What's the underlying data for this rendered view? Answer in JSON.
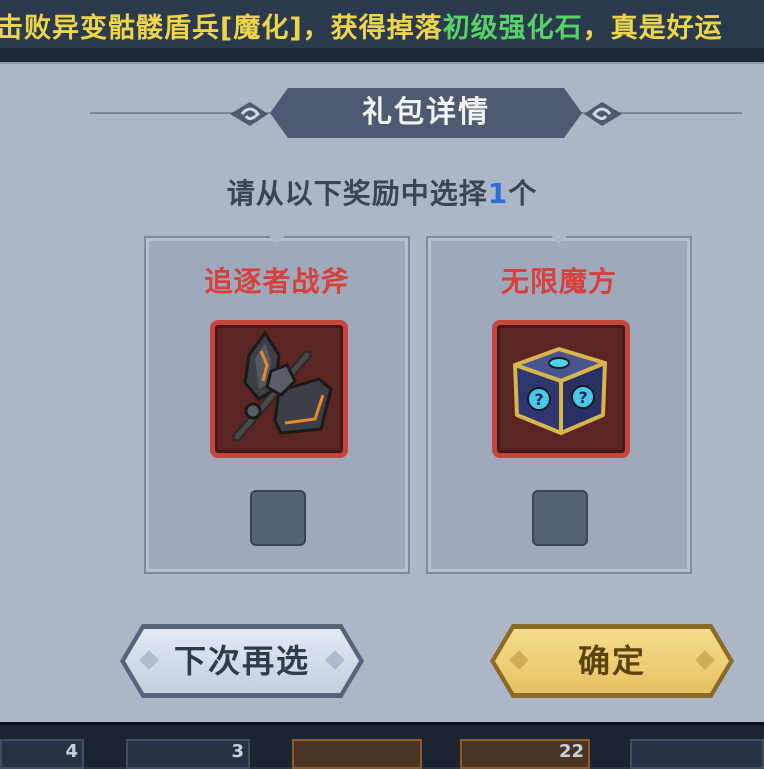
{
  "broadcast": {
    "part1": "击败异变骷髅盾兵[魔化]，获得掉落",
    "item": "初级强化石",
    "part2": "，真是好运"
  },
  "dialog": {
    "title": "礼包详情",
    "subtitle_prefix": "请从以下奖励中选择",
    "subtitle_count": "1",
    "subtitle_suffix": "个",
    "rewards": [
      {
        "name": "追逐者战斧",
        "icon": "battle-axe-icon",
        "selected": false
      },
      {
        "name": "无限魔方",
        "icon": "magic-cube-icon",
        "selected": false
      }
    ],
    "buttons": {
      "later": "下次再选",
      "confirm": "确定"
    }
  },
  "inventory_strip": {
    "counts": [
      "4",
      "3",
      "",
      "22"
    ]
  },
  "colors": {
    "reward_name": "#d6413d",
    "count_highlight": "#2c6fd6",
    "broadcast_text": "#ecd54a",
    "broadcast_item": "#57d36a",
    "confirm_button": "#e5c163",
    "item_frame": "#c8453c"
  }
}
